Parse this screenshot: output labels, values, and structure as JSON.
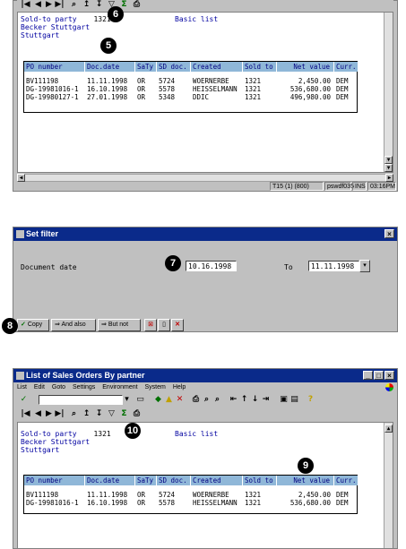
{
  "badges": {
    "b5": "5",
    "b6": "6",
    "b7": "7",
    "b8": "8",
    "b9": "9",
    "b10": "10"
  },
  "screen1": {
    "header": {
      "soldto_label": "Sold-to party",
      "soldto_value": "1321",
      "list_type": "Basic list",
      "line2": "Becker Stuttgart",
      "line3": "Stuttgart"
    },
    "table": {
      "headers": [
        "PO number",
        "Doc.date",
        "SaTy",
        "SD doc.",
        "Created",
        "Sold to",
        "Net value",
        "Curr."
      ],
      "rows": [
        [
          "BV111198",
          "11.11.1998",
          "OR",
          "5724",
          "WOERNERBE",
          "1321",
          "2,450.00",
          "DEM"
        ],
        [
          "DG-19981016-1",
          "16.10.1998",
          "OR",
          "5578",
          "HEISSELMANN",
          "1321",
          "536,680.00",
          "DEM"
        ],
        [
          "DG-19980127-1",
          "27.01.1998",
          "OR",
          "5348",
          "DDIC",
          "1321",
          "496,980.00",
          "DEM"
        ]
      ]
    },
    "status": {
      "system": "T15 (1) (800)",
      "server": "pswdf035",
      "mode": "INS",
      "time": "03:16PM"
    }
  },
  "dialog": {
    "title": "Set filter",
    "label": "Document date",
    "from_value": "10.16.1998",
    "to_label": "To",
    "to_value": "11.11.1998",
    "buttons": {
      "copy": "Copy",
      "and_also": "And also",
      "but_not": "But not"
    }
  },
  "screen2": {
    "title": "List of Sales Orders By partner",
    "menu": [
      "List",
      "Edit",
      "Goto",
      "Settings",
      "Environment",
      "System",
      "Help"
    ],
    "header": {
      "soldto_label": "Sold-to party",
      "soldto_value": "1321",
      "list_type": "Basic list",
      "line2": "Becker Stuttgart",
      "line3": "Stuttgart"
    },
    "table": {
      "headers": [
        "PO number",
        "Doc.date",
        "SaTy",
        "SD doc.",
        "Created",
        "Sold to",
        "Net value",
        "Curr."
      ],
      "rows": [
        [
          "BV111198",
          "11.11.1998",
          "OR",
          "5724",
          "WOERNERBE",
          "1321",
          "2,450.00",
          "DEM"
        ],
        [
          "DG-19981016-1",
          "16.10.1998",
          "OR",
          "5578",
          "HEISSELMANN",
          "1321",
          "536,680.00",
          "DEM"
        ]
      ]
    }
  }
}
